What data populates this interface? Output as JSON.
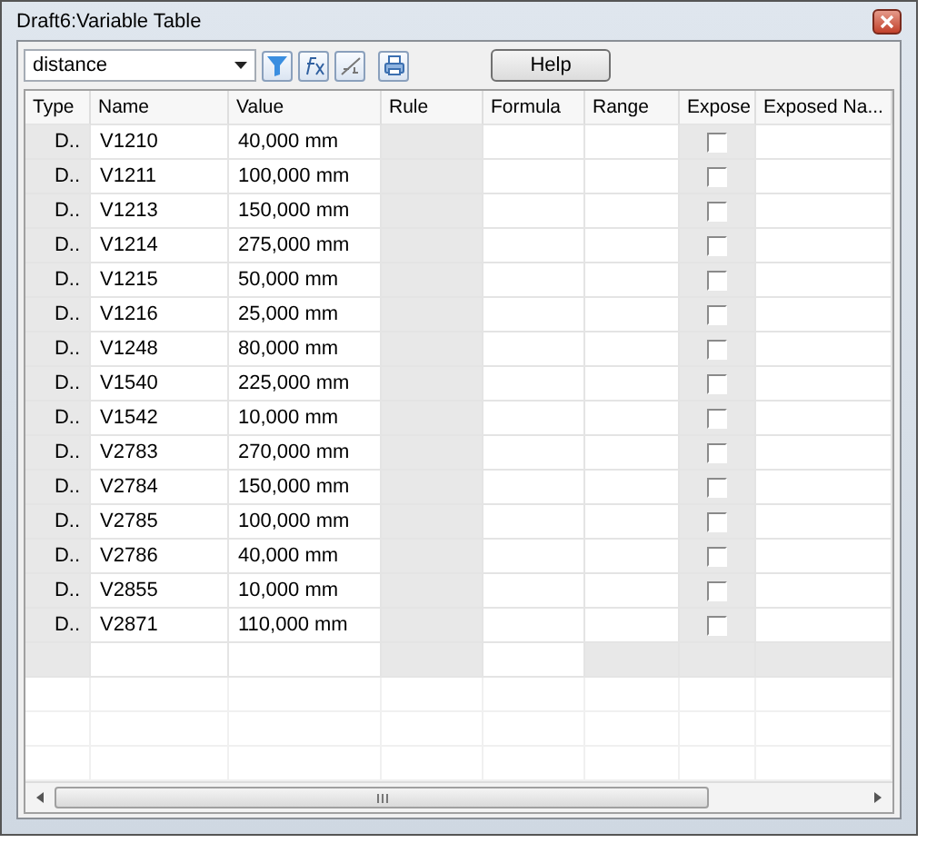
{
  "window": {
    "title": "Draft6:Variable Table"
  },
  "toolbar": {
    "filter_value": "distance",
    "help_button": "Help"
  },
  "table": {
    "columns": [
      "Type",
      "Name",
      "Value",
      "Rule",
      "Formula",
      "Range",
      "Expose",
      "Exposed Na..."
    ],
    "rows": [
      {
        "type": "D..",
        "name": "V1210",
        "value": "40,000 mm",
        "expose": false
      },
      {
        "type": "D..",
        "name": "V1211",
        "value": "100,000 mm",
        "expose": false
      },
      {
        "type": "D..",
        "name": "V1213",
        "value": "150,000 mm",
        "expose": false
      },
      {
        "type": "D..",
        "name": "V1214",
        "value": "275,000 mm",
        "expose": false
      },
      {
        "type": "D..",
        "name": "V1215",
        "value": "50,000 mm",
        "expose": false
      },
      {
        "type": "D..",
        "name": "V1216",
        "value": "25,000 mm",
        "expose": false
      },
      {
        "type": "D..",
        "name": "V1248",
        "value": "80,000 mm",
        "expose": false
      },
      {
        "type": "D..",
        "name": "V1540",
        "value": "225,000 mm",
        "expose": false
      },
      {
        "type": "D..",
        "name": "V1542",
        "value": "10,000 mm",
        "expose": false
      },
      {
        "type": "D..",
        "name": "V2783",
        "value": "270,000 mm",
        "expose": false
      },
      {
        "type": "D..",
        "name": "V2784",
        "value": "150,000 mm",
        "expose": false
      },
      {
        "type": "D..",
        "name": "V2785",
        "value": "100,000 mm",
        "expose": false
      },
      {
        "type": "D..",
        "name": "V2786",
        "value": "40,000 mm",
        "expose": false
      },
      {
        "type": "D..",
        "name": "V2855",
        "value": "10,000 mm",
        "expose": false
      },
      {
        "type": "D..",
        "name": "V2871",
        "value": "110,000 mm",
        "expose": false
      }
    ]
  }
}
